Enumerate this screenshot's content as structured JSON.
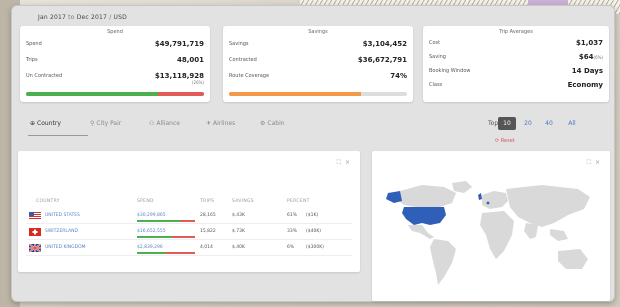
{
  "header": {
    "from": "Jan 2017",
    "to_word": "to",
    "to": "Dec 2017",
    "separator": "/",
    "currency": "USD"
  },
  "spend": {
    "title": "Spend",
    "rows": [
      {
        "label": "Spend",
        "value": "$49,791,719"
      },
      {
        "label": "Trips",
        "value": "48,001"
      },
      {
        "label": "Un Contracted",
        "value": "$13,118,928",
        "sub": "(26%)"
      }
    ],
    "bar": {
      "contracted_fraction": 0.74,
      "uncontracted_fraction": 0.26,
      "colors": [
        "#4caf50",
        "#e25b5b"
      ]
    }
  },
  "savings": {
    "title": "Savings",
    "rows": [
      {
        "label": "Savings",
        "value": "$3,104,452"
      },
      {
        "label": "Contracted",
        "value": "$36,672,791"
      },
      {
        "label": "Route Coverage",
        "value": "74%"
      }
    ],
    "bar": {
      "fraction": 0.74,
      "color": "#f39a4a"
    }
  },
  "trip_averages": {
    "title": "Trip Averages",
    "rows": [
      {
        "label": "Cost",
        "value": "$1,037"
      },
      {
        "label": "Saving",
        "value": "$64",
        "sub": "(6%)"
      },
      {
        "label": "Booking Window",
        "value": "14 Days"
      },
      {
        "label": "Class",
        "value": "Economy"
      }
    ]
  },
  "tabs": [
    {
      "label": "Country",
      "icon": "globe-icon",
      "glyph": "⊕"
    },
    {
      "label": "City Pair",
      "icon": "pin-icon",
      "glyph": "⚲"
    },
    {
      "label": "Alliance",
      "icon": "people-icon",
      "glyph": "⚇"
    },
    {
      "label": "Airlines",
      "icon": "plane-icon",
      "glyph": "✈"
    },
    {
      "label": "Cabin",
      "icon": "cabin-icon",
      "glyph": "⚙"
    }
  ],
  "top": {
    "label": "Top",
    "options": [
      "10",
      "20",
      "40",
      "All"
    ],
    "selected": "10",
    "reset_label": "Reset",
    "reset_glyph": "⟳"
  },
  "table": {
    "columns": [
      "COUNTRY",
      "SPEND",
      "TRIPS",
      "SAVINGS",
      "PERCENT"
    ],
    "rows": [
      {
        "country": "UNITED STATES",
        "spend": "$30,299,865",
        "trips": "28,165",
        "savings": "$.43K",
        "percent": "61%",
        "extra": "($1K)",
        "spend_fraction": 0.74,
        "flag": "us"
      },
      {
        "country": "SWITZERLAND",
        "spend": "$16,652,555",
        "trips": "15,822",
        "savings": "$.73K",
        "percent": "33%",
        "extra": "($40K)",
        "spend_fraction": 0.6,
        "flag": "ch"
      },
      {
        "country": "UNITED KINGDOM",
        "spend": "$2,839,296",
        "trips": "4,014",
        "savings": "$.40K",
        "percent": "6%",
        "extra": "($300K)",
        "spend_fraction": 0.5,
        "flag": "gb"
      }
    ]
  },
  "panel_controls": {
    "expand": "⛶",
    "close": "×"
  },
  "colors": {
    "accent": "#4a76c7",
    "highlight_country": "#2f5fb8",
    "land": "#d9d9d9"
  }
}
